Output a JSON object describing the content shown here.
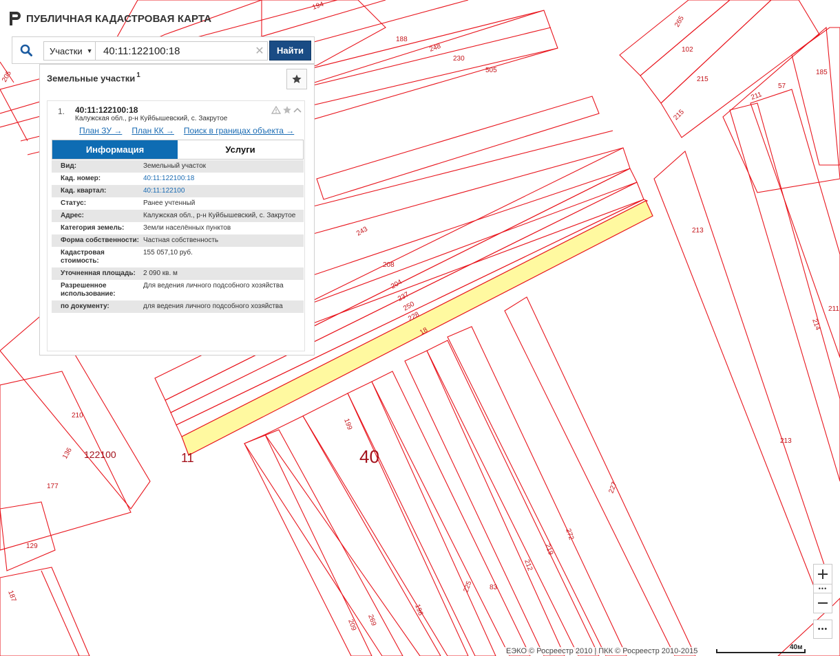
{
  "app": {
    "title": "ПУБЛИЧНАЯ КАДАСТРОВАЯ КАРТА"
  },
  "search": {
    "type_selected": "Участки",
    "query": "40:11:122100:18",
    "button_label": "Найти"
  },
  "panel": {
    "title": "Земельные участки",
    "count": "1",
    "result": {
      "index": "1.",
      "cad_number": "40:11:122100:18",
      "address_short": "Калужская обл., р-н Куйбышевский, с. Закрутое",
      "links": [
        "План ЗУ →",
        "План КК →",
        "Поиск в границах объекта →"
      ],
      "tabs": {
        "info": "Информация",
        "services": "Услуги"
      },
      "attributes": [
        {
          "key": "Вид:",
          "value": "Земельный участок"
        },
        {
          "key": "Кад. номер:",
          "value": "40:11:122100:18"
        },
        {
          "key": "Кад. квартал:",
          "value": "40:11:122100"
        },
        {
          "key": "Статус:",
          "value": "Ранее учтенный"
        },
        {
          "key": "Адрес:",
          "value": "Калужская обл., р-н Куйбышевский, с. Закрутое"
        },
        {
          "key": "Категория земель:",
          "value": "Земли населённых пунктов"
        },
        {
          "key": "Форма собственности:",
          "value": "Частная собственность"
        },
        {
          "key": "Кадастровая стоимость:",
          "value": "155 057,10 руб."
        },
        {
          "key": "Уточненная площадь:",
          "value": "2 090 кв. м"
        },
        {
          "key": "Разрешенное использование:",
          "value": "Для ведения личного подсобного хозяйства"
        },
        {
          "key": "по документу:",
          "value": "для ведения личного подсобного хозяйства"
        }
      ]
    }
  },
  "map": {
    "quarter_label": "122100",
    "block_label": "40",
    "boundary_label": "11",
    "parcel_labels": {
      "p194": "194",
      "p265": "265",
      "p188": "188",
      "p248": "248",
      "p230": "230",
      "p505": "505",
      "p102": "102",
      "p215a": "215",
      "p215b": "215",
      "p185": "185",
      "p211a": "211",
      "p57": "57",
      "p205": "205",
      "p243": "243",
      "p208": "208",
      "p204": "204",
      "p237": "237",
      "p250": "250",
      "p228": "228",
      "p18": "18",
      "p213a": "213",
      "p213b": "213",
      "p211b": "211",
      "p214": "214",
      "p210": "210",
      "p136": "136",
      "p177": "177",
      "p129": "129",
      "p187": "187",
      "p199": "199",
      "p227": "227",
      "p272": "272",
      "p219": "219",
      "p212": "212",
      "p83": "83",
      "p225": "225",
      "p196": "196",
      "p269": "269",
      "p209": "209"
    }
  },
  "footer": {
    "copyright": "ЕЭКО © Росреестр 2010 | ПКК © Росреестр 2010-2015",
    "scale": "40м"
  },
  "colors": {
    "parcel_boundary": "#e8141c",
    "selected_fill": "#fff9a0",
    "find_button": "#1a4c85",
    "active_tab": "#0e6cb3",
    "link": "#1a6bb3"
  }
}
